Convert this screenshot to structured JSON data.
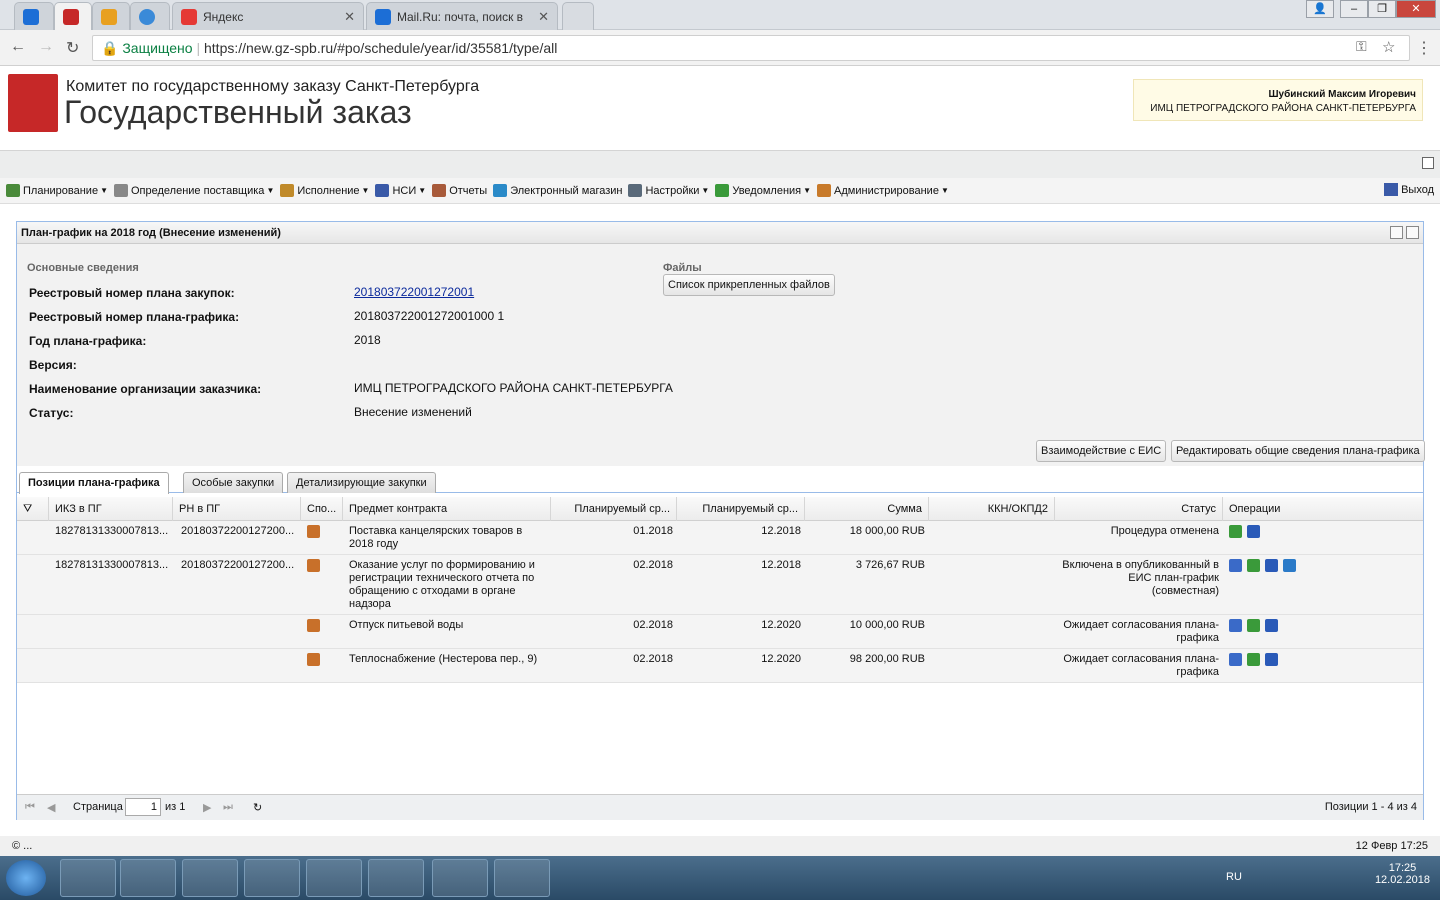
{
  "browser": {
    "tabs": [
      {
        "label": ""
      },
      {
        "label": ""
      },
      {
        "label": ""
      },
      {
        "label": ""
      },
      {
        "label": "Яндекс"
      },
      {
        "label": "Mail.Ru: почта, поиск в"
      }
    ],
    "secure_label": "Защищено",
    "url": "https://new.gz-spb.ru/#po/schedule/year/id/35581/type/all"
  },
  "header": {
    "org_line1": "Комитет по государственному заказу Санкт-Петербурга",
    "org_line2": "Государственный заказ",
    "user_name": "Шубинский Максим Игоревич",
    "user_org": "ИМЦ ПЕТРОГРАДСКОГО РАЙОНА САНКТ-ПЕТЕРБУРГА"
  },
  "menu": {
    "items": [
      {
        "label": "Планирование",
        "icon": "planning-icon",
        "color": "#4a8a3a"
      },
      {
        "label": "Определение поставщика",
        "icon": "gears-icon",
        "color": "#888888"
      },
      {
        "label": "Исполнение",
        "icon": "execution-icon",
        "color": "#c08a2a"
      },
      {
        "label": "НСИ",
        "icon": "book-icon",
        "color": "#3a5aa8"
      },
      {
        "label": "Отчеты",
        "icon": "report-icon",
        "color": "#a85a3a"
      },
      {
        "label": "Электронный магазин",
        "icon": "cart-icon",
        "color": "#2a8ac8"
      },
      {
        "label": "Настройки",
        "icon": "wrench-icon",
        "color": "#5a6a7a"
      },
      {
        "label": "Уведомления",
        "icon": "envelope-icon",
        "color": "#3a9a3a"
      },
      {
        "label": "Администрирование",
        "icon": "user-icon",
        "color": "#c87a2a"
      }
    ],
    "logout_label": "Выход"
  },
  "panel": {
    "title": "План-график на 2018 год (Внесение изменений)",
    "section_main": "Основные сведения",
    "section_files": "Файлы",
    "files_button": "Список прикрепленных файлов",
    "fields": [
      {
        "label": "Реестровый номер плана закупок:",
        "value": "201803722001272001"
      },
      {
        "label": "Реестровый номер плана-графика:",
        "value": "201803722001272001000 1"
      },
      {
        "label": "Год плана-графика:",
        "value": "2018"
      },
      {
        "label": "Версия:",
        "value": ""
      },
      {
        "label": "Наименование организации заказчика:",
        "value": "ИМЦ ПЕТРОГРАДСКОГО РАЙОНА САНКТ-ПЕТЕРБУРГА"
      },
      {
        "label": "Статус:",
        "value": "Внесение изменений"
      }
    ],
    "btn_eis": "Взаимодействие с ЕИС",
    "btn_edit": "Редактировать общие сведения плана-графика"
  },
  "tabs": [
    {
      "label": "Позиции плана-графика"
    },
    {
      "label": "Особые закупки"
    },
    {
      "label": "Детализирующие закупки"
    }
  ],
  "grid": {
    "columns": [
      "ИКЗ в ПГ",
      "РН в ПГ",
      "Спо...",
      "Предмет контракта",
      "Планируемый ср...",
      "Планируемый ср...",
      "Сумма",
      "ККН/ОКПД2",
      "Статус",
      "Операции"
    ],
    "rows": [
      {
        "ikz": "18278131330007813...",
        "rn": "20180372200127200...",
        "subject": "Поставка канцелярских товаров в 2018 году",
        "start": "01.2018",
        "end": "12.2018",
        "sum": "18 000,00 RUB",
        "kkn": "",
        "status": "Процедура отменена"
      },
      {
        "ikz": "18278131330007813...",
        "rn": "20180372200127200...",
        "subject": "Оказание услуг по формированию и регистрации технического отчета по обращению с отходами в органе надзора",
        "start": "02.2018",
        "end": "12.2018",
        "sum": "3 726,67 RUB",
        "kkn": "",
        "status": "Включена в опубликованный в ЕИС план-график (совместная)"
      },
      {
        "ikz": "",
        "rn": "",
        "subject": "Отпуск питьевой воды",
        "start": "02.2018",
        "end": "12.2020",
        "sum": "10 000,00 RUB",
        "kkn": "",
        "status": "Ожидает согласования плана-графика"
      },
      {
        "ikz": "",
        "rn": "",
        "subject": "Теплоснабжение (Нестерова пер., 9)",
        "start": "02.2018",
        "end": "12.2020",
        "sum": "98 200,00 RUB",
        "kkn": "",
        "status": "Ожидает согласования плана-графика"
      }
    ]
  },
  "pager": {
    "page_label": "Страница",
    "page_value": "1",
    "of_label": "из 1",
    "summary": "Позиции 1 - 4 из 4"
  },
  "statusbar": {
    "left": "© ...",
    "right": "12 Февр 17:25"
  },
  "taskbar": {
    "lang": "RU",
    "time": "17:25",
    "date": "12.02.2018"
  }
}
